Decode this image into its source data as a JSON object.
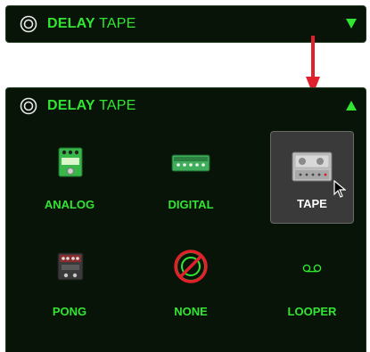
{
  "collapsed_panel": {
    "title_bold": "DELAY",
    "title_thin": "TAPE"
  },
  "expanded_panel": {
    "title_bold": "DELAY",
    "title_thin": "TAPE",
    "options": [
      {
        "label": "ANALOG"
      },
      {
        "label": "DIGITAL"
      },
      {
        "label": "TAPE",
        "selected": true
      },
      {
        "label": "PONG"
      },
      {
        "label": "NONE"
      },
      {
        "label": "LOOPER"
      }
    ]
  },
  "colors": {
    "panel_bg": "#081408",
    "accent_green": "#33e533",
    "selected_bg": "#3a3a3a",
    "arrow_red": "#e0202a"
  }
}
